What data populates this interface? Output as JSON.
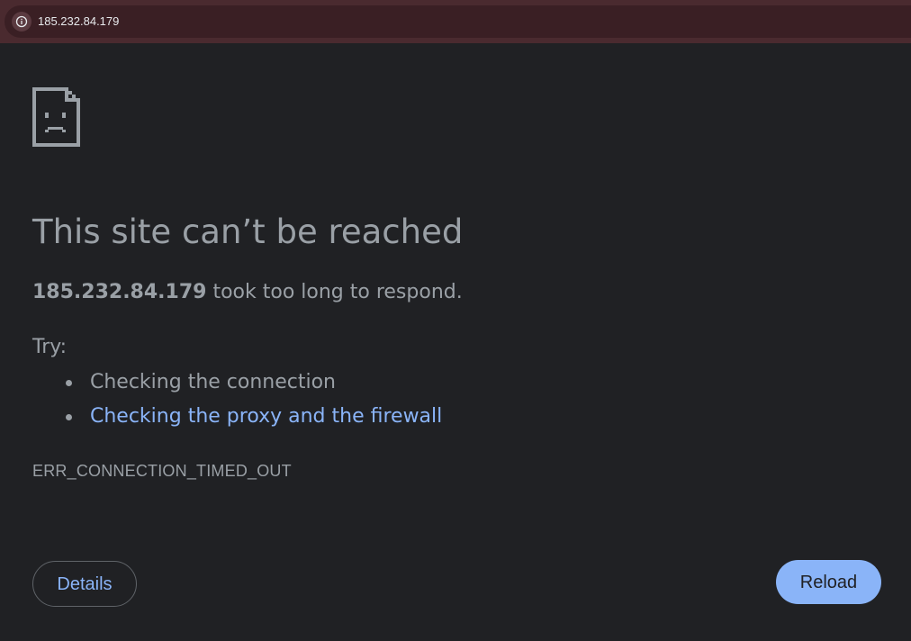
{
  "address_bar": {
    "url": "185.232.84.179",
    "icon": "info-icon"
  },
  "error_page": {
    "icon": "sad-page-icon",
    "headline": "This site can’t be reached",
    "host": "185.232.84.179",
    "description_suffix": " took too long to respond.",
    "try_label": "Try:",
    "suggestions": [
      {
        "label": "Checking the connection",
        "is_link": false
      },
      {
        "label": "Checking the proxy and the firewall",
        "is_link": true
      }
    ],
    "error_code": "ERR_CONNECTION_TIMED_OUT",
    "details_label": "Details",
    "reload_label": "Reload"
  },
  "colors": {
    "background": "#202124",
    "text": "#9aa0a6",
    "link": "#8ab4f8",
    "toolbar": "#4a2a2f",
    "omnibox": "#3a1f24"
  }
}
